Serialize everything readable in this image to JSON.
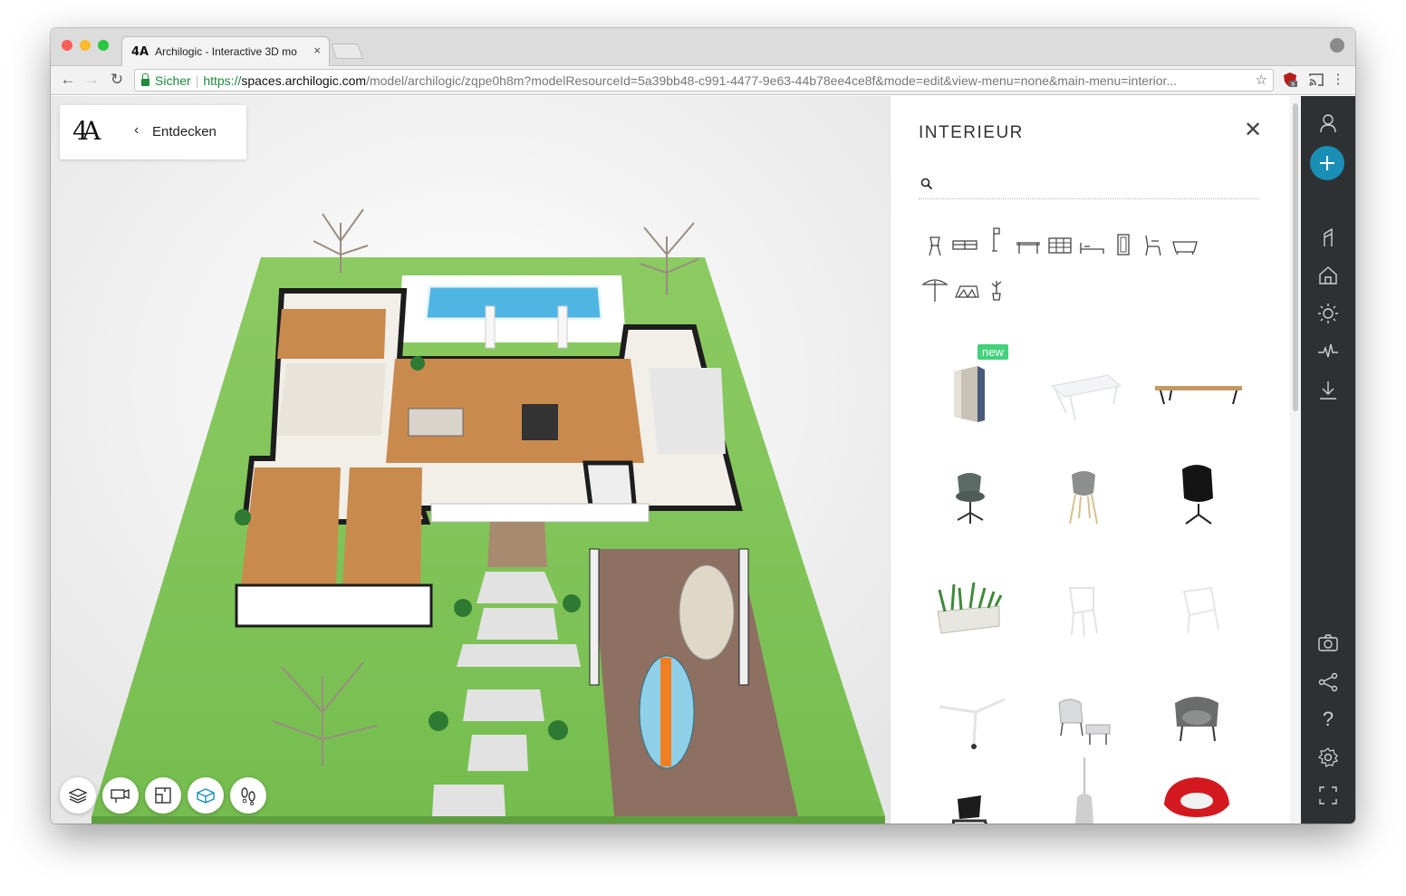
{
  "browser": {
    "tab_title": "Archilogic - Interactive 3D mo",
    "tab_close": "×",
    "url_secure_label": "Sicher",
    "url_scheme": "https://",
    "url_host": "spaces.archilogic.com",
    "url_path": "/model/archilogic/zqpe0h8m?modelResourceId=5a39bb48-c991-4477-9e63-44b78ee4ce8f&mode=edit&view-menu=none&main-menu=interior...",
    "ext_badge": "6"
  },
  "app": {
    "logo_text": "4A",
    "back_label": "Entdecken",
    "bottom_tools": [
      "layers-icon",
      "camera-mount-icon",
      "floorplan-icon",
      "3d-box-icon",
      "walk-footsteps-icon"
    ]
  },
  "panel": {
    "title": "INTERIEUR",
    "search_placeholder": "",
    "categories": [
      "chair-icon",
      "sofa-icon",
      "lamp-icon",
      "table-icon",
      "shelf-icon",
      "bed-icon",
      "mirror-icon",
      "armchair-icon",
      "bathtub-icon",
      "parasol-icon",
      "rug-icon",
      "plant-icon"
    ],
    "new_badge": "new",
    "items": [
      "phone-booth",
      "glass-table",
      "wood-bench",
      "grey-swivel-chair",
      "grey-shell-chair",
      "black-lounge-chair",
      "planter-box",
      "white-wire-chair",
      "white-wire-chair-low",
      "white-side-table",
      "lounge-chair-ottoman",
      "grey-armchair",
      "black-cantilever-chair",
      "pendant-lamp",
      "red-egg-chair"
    ]
  },
  "rail": {
    "icons_top": [
      "user-icon",
      "add-icon",
      "wall-tool-icon",
      "home-icon",
      "light-sun-icon",
      "activity-icon",
      "download-icon"
    ],
    "icons_bottom": [
      "camera-icon",
      "share-icon",
      "help-icon",
      "settings-icon",
      "fullscreen-icon"
    ],
    "help_glyph": "?",
    "accent": "#1a8fb6"
  },
  "colors": {
    "lawn": "#7cc357",
    "rail": "#2e3133",
    "new_badge": "#43d17c"
  }
}
